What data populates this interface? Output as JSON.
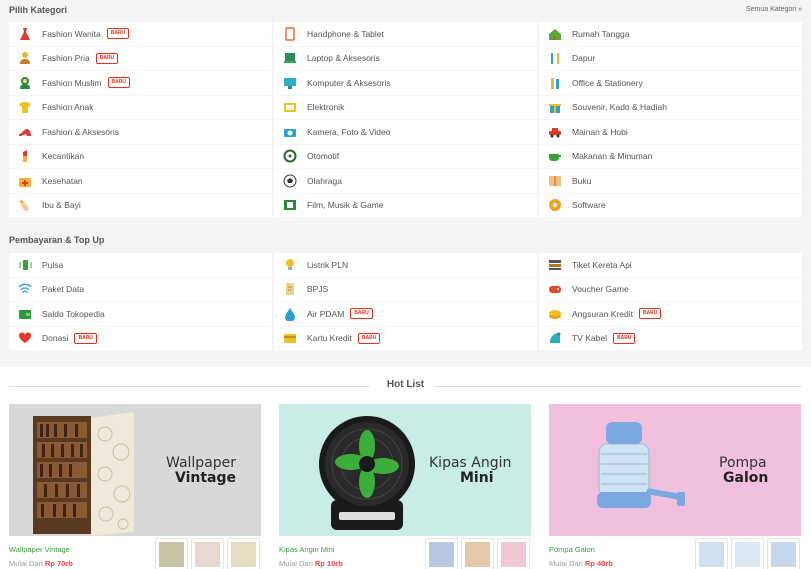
{
  "categories": {
    "title": "Pilih Kategori",
    "see_all": "Semua Kategori »",
    "items": [
      {
        "label": "Fashion Wanita",
        "badge": "BARU",
        "icon": "dress-icon"
      },
      {
        "label": "Handphone & Tablet",
        "icon": "phone-icon"
      },
      {
        "label": "Rumah Tangga",
        "icon": "house-icon"
      },
      {
        "label": "Fashion Pria",
        "badge": "BARU",
        "icon": "man-icon"
      },
      {
        "label": "Laptop & Aksesoris",
        "icon": "laptop-icon"
      },
      {
        "label": "Dapur",
        "icon": "kitchen-icon"
      },
      {
        "label": "Fashion Muslim",
        "badge": "BARU",
        "icon": "hijab-icon"
      },
      {
        "label": "Komputer & Aksesoris",
        "icon": "monitor-icon"
      },
      {
        "label": "Office & Stationery",
        "icon": "pencil-icon"
      },
      {
        "label": "Fashion Anak",
        "icon": "tshirt-icon"
      },
      {
        "label": "Elektronik",
        "icon": "tv-icon"
      },
      {
        "label": "Souvenir, Kado & Hadiah",
        "icon": "gift-icon"
      },
      {
        "label": "Fashion & Aksesoris",
        "icon": "heel-icon"
      },
      {
        "label": "Kamera, Foto & Video",
        "icon": "camera-icon"
      },
      {
        "label": "Mainan & Hobi",
        "icon": "car-toy-icon"
      },
      {
        "label": "Kecantikan",
        "icon": "lipstick-icon"
      },
      {
        "label": "Otomotif",
        "icon": "steering-icon"
      },
      {
        "label": "Makanan & Minuman",
        "icon": "cup-icon"
      },
      {
        "label": "Kesehatan",
        "icon": "medkit-icon"
      },
      {
        "label": "Olahraga",
        "icon": "ball-icon"
      },
      {
        "label": "Buku",
        "icon": "book-icon"
      },
      {
        "label": "Ibu & Bayi",
        "icon": "bottle-icon"
      },
      {
        "label": "Film, Musik & Game",
        "icon": "film-icon"
      },
      {
        "label": "Software",
        "icon": "disc-icon"
      }
    ]
  },
  "payments": {
    "title": "Pembayaran & Top Up",
    "items": [
      {
        "label": "Pulsa",
        "icon": "phone-signal-icon"
      },
      {
        "label": "Listrik PLN",
        "icon": "bulb-icon"
      },
      {
        "label": "Tiket Kereta Api",
        "icon": "train-icon"
      },
      {
        "label": "Paket Data",
        "icon": "wifi-icon"
      },
      {
        "label": "BPJS",
        "icon": "document-icon"
      },
      {
        "label": "Voucher Game",
        "icon": "gamepad-icon"
      },
      {
        "label": "Saldo Tokopedia",
        "icon": "wallet-icon"
      },
      {
        "label": "Air PDAM",
        "badge": "BARU",
        "icon": "water-drop-icon"
      },
      {
        "label": "Angsuran Kredit",
        "badge": "BARU",
        "icon": "coins-icon"
      },
      {
        "label": "Donasi",
        "badge": "BARU",
        "icon": "heart-hand-icon"
      },
      {
        "label": "Kartu Kredit",
        "badge": "BARU",
        "icon": "credit-card-icon"
      },
      {
        "label": "TV Kabel",
        "badge": "BARU",
        "icon": "satellite-icon"
      }
    ]
  },
  "hotlist": {
    "title": "Hot List",
    "cards": [
      {
        "line1": "Wallpaper",
        "line2": "Vintage",
        "name": "Wallpaper Vintage",
        "price_prefix": "Mulai Dari",
        "price": "Rp 70rb",
        "bg": "#d8d8d8"
      },
      {
        "line1": "Kipas Angin",
        "line2": "Mini",
        "name": "Kipas Angin Mini",
        "price_prefix": "Mulai Dari",
        "price": "Rp 10rb",
        "bg": "#c8ece6"
      },
      {
        "line1": "Pompa",
        "line2": "Galon",
        "name": "Pompa Galon",
        "price_prefix": "Mulai Dari",
        "price": "Rp 40rb",
        "bg": "#f0c0de"
      }
    ]
  },
  "colors": {
    "badge": "#dd3322",
    "product_name": "#3a9b3a",
    "price": "#ff4444"
  }
}
